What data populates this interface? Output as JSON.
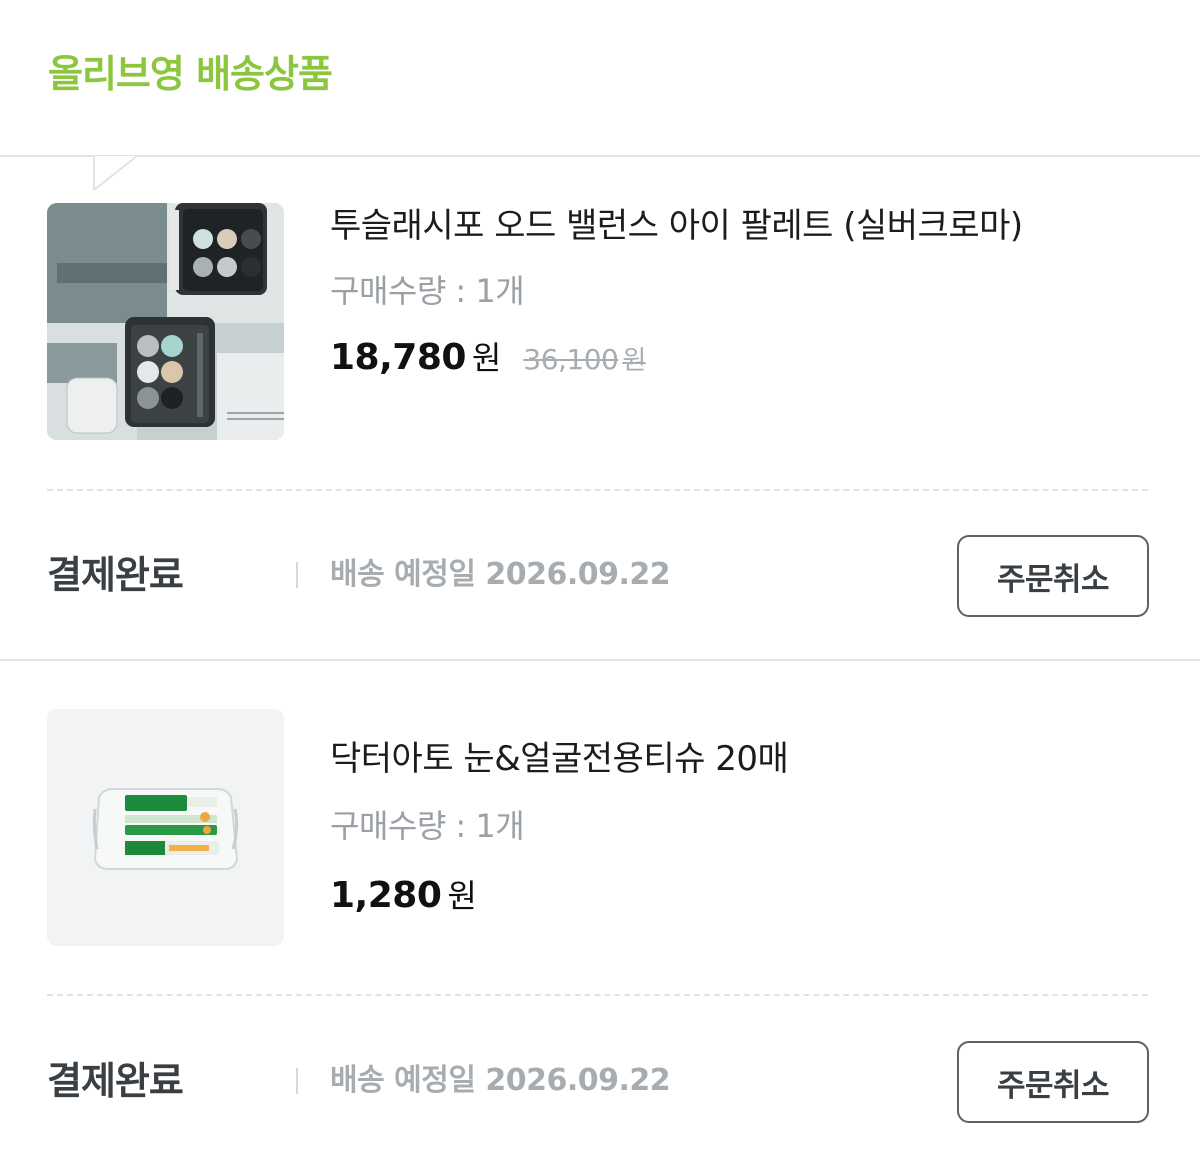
{
  "section": {
    "title": "올리브영 배송상품"
  },
  "products": [
    {
      "name": "투슬래시포 오드 밸런스 아이 팔레트 (실버크로마)",
      "quantity_text": "구매수량 : 1개",
      "price": "18,780",
      "price_unit": "원",
      "original_price": "36,100",
      "original_price_unit": "원",
      "image_icon": "eyeshadow-palette-image",
      "status": "결제완료",
      "delivery_text": "배송 예정일 2026.09.22",
      "cancel_label": "주문취소"
    },
    {
      "name": "닥터아토 눈&얼굴전용티슈 20매",
      "quantity_text": "구매수량 : 1개",
      "price": "1,280",
      "price_unit": "원",
      "image_icon": "wet-tissue-pack-image",
      "status": "결제완료",
      "delivery_text": "배송 예정일 2026.09.22",
      "cancel_label": "주문취소"
    }
  ],
  "colors": {
    "accent_green": "#8cc63f",
    "text_dark": "#111111",
    "text_muted": "#9aa0a5",
    "divider": "#e3e3e3"
  }
}
